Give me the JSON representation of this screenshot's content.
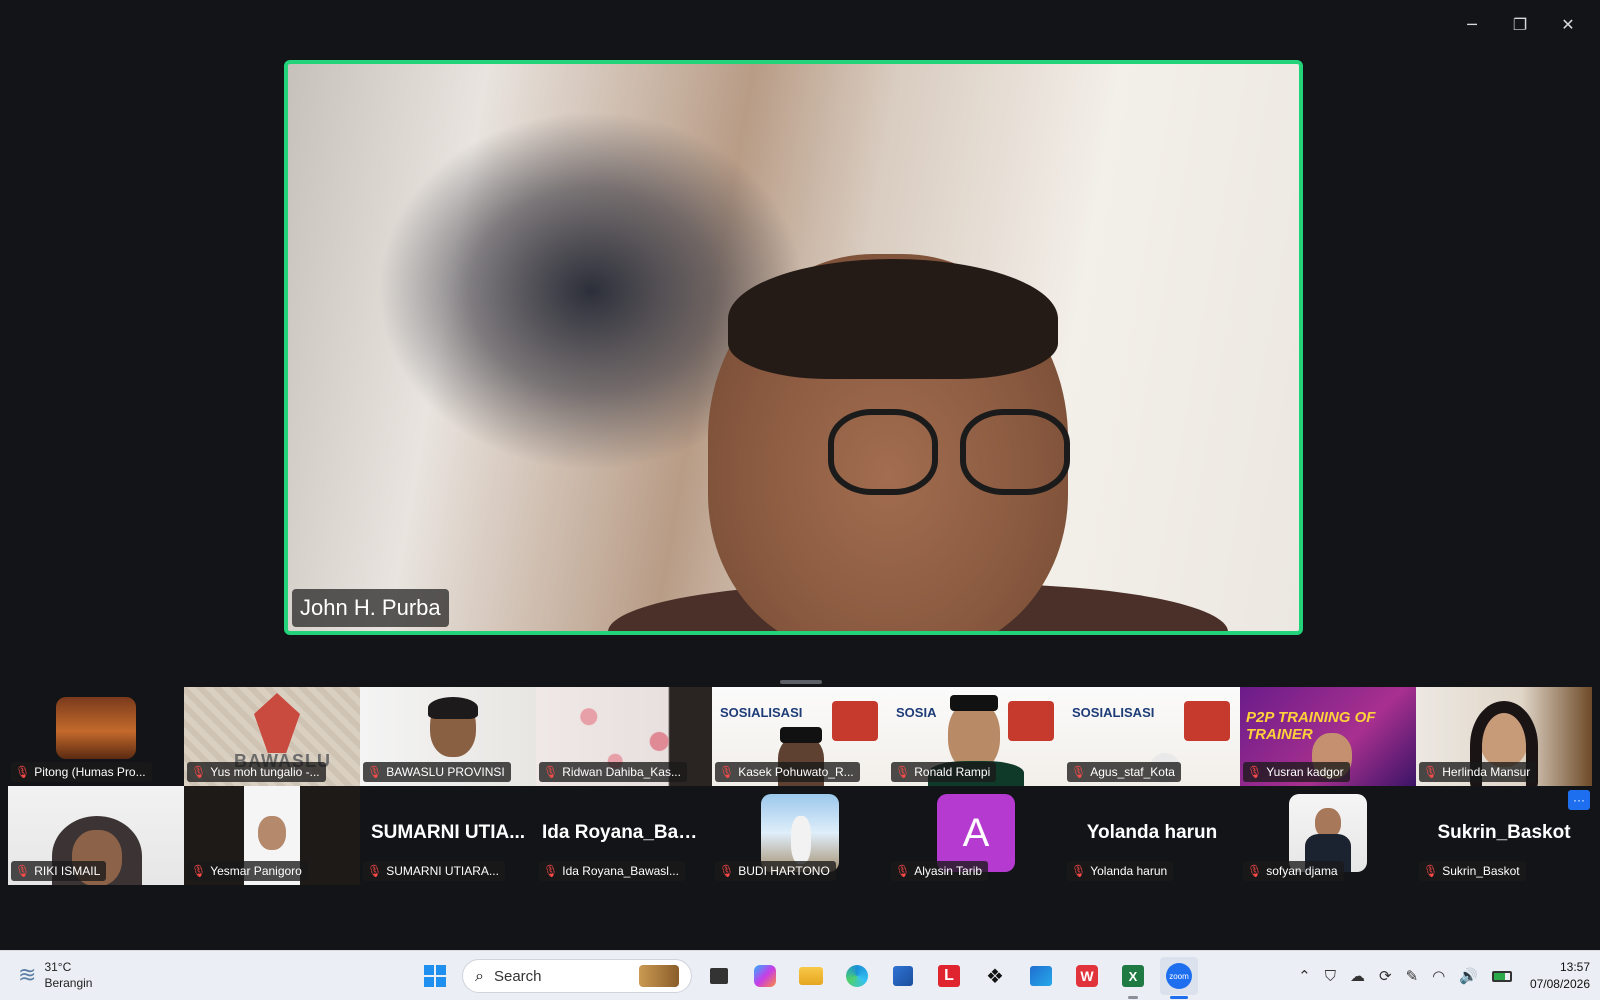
{
  "window": {
    "minimize": "─",
    "restore": "❐",
    "close": "✕"
  },
  "speaker": {
    "name": "John H. Purba",
    "highlight_color": "#22d37a"
  },
  "participants": [
    {
      "display": "Pitong (Humas Pro...",
      "big": "",
      "kind": "video"
    },
    {
      "display": "Yus moh tungalio -...",
      "big": "",
      "kind": "video"
    },
    {
      "display": "BAWASLU PROVINSI",
      "big": "",
      "kind": "video"
    },
    {
      "display": "Ridwan Dahiba_Kas...",
      "big": "",
      "kind": "video"
    },
    {
      "display": "Kasek Pohuwato_R...",
      "big": "",
      "kind": "video"
    },
    {
      "display": "Ronald Rampi",
      "big": "",
      "kind": "video"
    },
    {
      "display": "Agus_staf_Kota",
      "big": "",
      "kind": "video"
    },
    {
      "display": "Yusran kadgor",
      "big": "",
      "kind": "video"
    },
    {
      "display": "Herlinda Mansur",
      "big": "",
      "kind": "video"
    },
    {
      "display": "RIKI ISMAIL",
      "big": "",
      "kind": "video"
    },
    {
      "display": "Yesmar Panigoro",
      "big": "",
      "kind": "video"
    },
    {
      "display": "SUMARNI UTIARA...",
      "big": "SUMARNI UTIA...",
      "kind": "name"
    },
    {
      "display": "Ida Royana_Bawasl...",
      "big": "Ida Royana_Baw...",
      "kind": "name"
    },
    {
      "display": "BUDI HARTONO",
      "big": "",
      "kind": "photo"
    },
    {
      "display": "Alyasin Tarib",
      "big": "A",
      "kind": "avatar"
    },
    {
      "display": "Yolanda harun",
      "big": "Yolanda harun",
      "kind": "name"
    },
    {
      "display": "sofyan djama",
      "big": "",
      "kind": "photo"
    },
    {
      "display": "Sukrin_Baskot",
      "big": "Sukrin_Baskot",
      "kind": "name"
    }
  ],
  "strip": {
    "more_label": "···"
  },
  "taskbar": {
    "weather_temp": "31°C",
    "weather_desc": "Berangin",
    "search_placeholder": "Search",
    "time": "13:57",
    "date": "07/08/2026",
    "apps": [
      "start-icon",
      "task-view-icon",
      "copilot-icon",
      "file-explorer-icon",
      "edge-icon",
      "store-icon",
      "l-app-icon",
      "dropbox-icon",
      "outlook-icon",
      "wps-icon",
      "excel-icon",
      "zoom-icon"
    ]
  }
}
